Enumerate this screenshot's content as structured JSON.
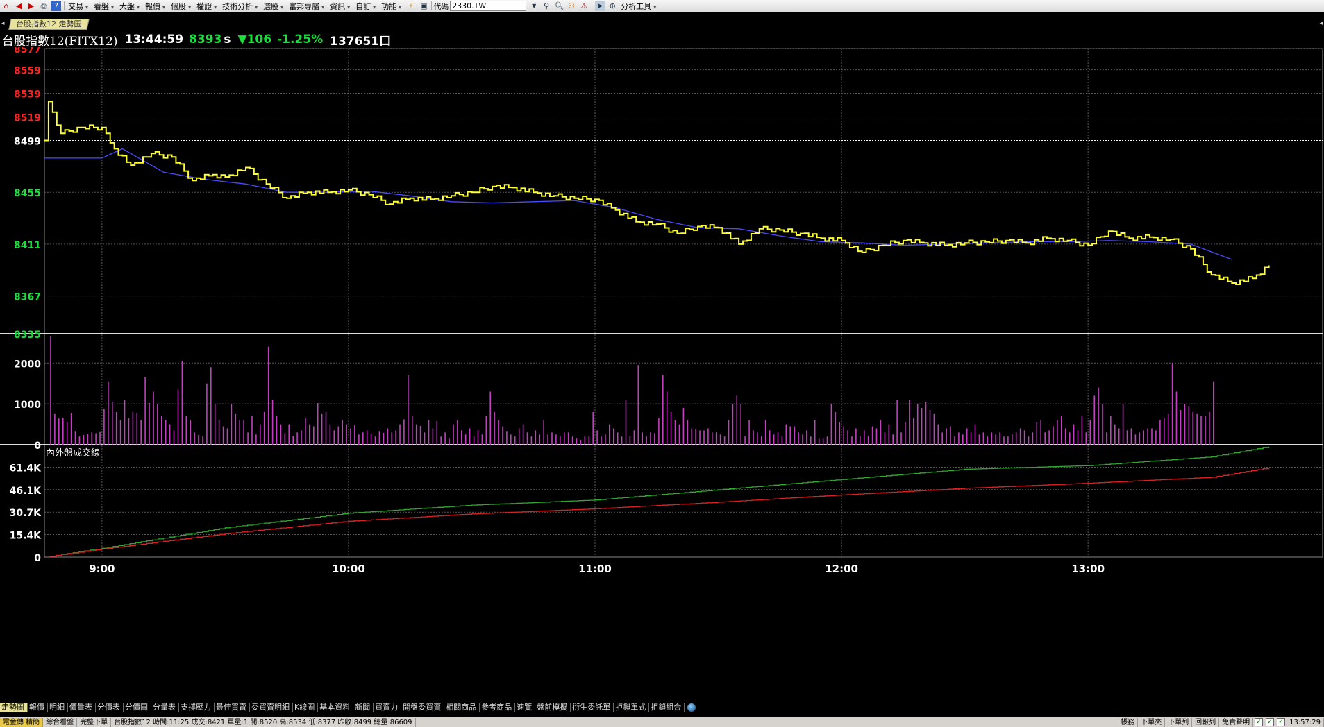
{
  "toolbar": {
    "menus": [
      "交易",
      "看盤",
      "大盤",
      "報價",
      "個股",
      "權證",
      "技術分析",
      "選股",
      "富邦專屬",
      "資訊",
      "自訂",
      "功能"
    ],
    "code_label": "代碼",
    "code_value": "2330.TW",
    "analysis_tools": "分析工具"
  },
  "tab": {
    "label": "台股指數12 走勢圖"
  },
  "header": {
    "name": "台股指數12(FITX12)",
    "time": "13:44:59",
    "price": "8393",
    "price_unit": "s",
    "change": "▼106",
    "change_pct": "-1.25%",
    "volume": "137651口"
  },
  "panels": {
    "cumulative_label": "內外盤成交線"
  },
  "colors": {
    "price_line": "#ffff33",
    "avg_line": "#4a4aff",
    "volume_bar": "#c040c0",
    "outer_line": "#2fa82f",
    "inner_line": "#e02020",
    "up": "#ff2020",
    "down": "#19e03b",
    "grid": "#555555",
    "ref_line": "#ffffff"
  },
  "chart_data": [
    {
      "type": "line",
      "title": "台股指數12(FITX12)",
      "x_axis_ticks": [
        "9:00",
        "10:00",
        "11:00",
        "12:00",
        "13:00"
      ],
      "y_axis_ticks_up": [
        "8577",
        "8559",
        "8539",
        "8519"
      ],
      "y_axis_ticks_ref": "8499",
      "y_axis_ticks_down": [
        "8455",
        "8411",
        "8367",
        "8335"
      ],
      "ylim": [
        8335,
        8577
      ],
      "reference_price": 8499,
      "series": [
        {
          "name": "price",
          "x": [
            "08:46",
            "08:47",
            "08:50",
            "08:55",
            "09:00",
            "09:03",
            "09:07",
            "09:12",
            "09:17",
            "09:22",
            "09:27",
            "09:30",
            "09:35",
            "09:40",
            "09:45",
            "09:50",
            "09:55",
            "10:00",
            "10:05",
            "10:10",
            "10:15",
            "10:20",
            "10:25",
            "10:30",
            "10:35",
            "10:40",
            "10:45",
            "10:50",
            "10:55",
            "11:00",
            "11:05",
            "11:10",
            "11:15",
            "11:20",
            "11:25",
            "11:30",
            "11:35",
            "11:40",
            "11:45",
            "11:50",
            "11:55",
            "12:00",
            "12:05",
            "12:10",
            "12:15",
            "12:20",
            "12:25",
            "12:30",
            "12:35",
            "12:40",
            "12:45",
            "12:50",
            "12:55",
            "13:00",
            "13:05",
            "13:10",
            "13:15",
            "13:20",
            "13:25",
            "13:30",
            "13:35",
            "13:40",
            "13:44"
          ],
          "values": [
            8499,
            8532,
            8505,
            8510,
            8510,
            8492,
            8478,
            8488,
            8485,
            8465,
            8470,
            8468,
            8476,
            8462,
            8450,
            8455,
            8455,
            8457,
            8453,
            8445,
            8450,
            8449,
            8452,
            8455,
            8460,
            8459,
            8455,
            8452,
            8450,
            8449,
            8440,
            8430,
            8428,
            8420,
            8426,
            8425,
            8411,
            8424,
            8423,
            8420,
            8416,
            8414,
            8404,
            8410,
            8414,
            8412,
            8410,
            8412,
            8413,
            8414,
            8412,
            8416,
            8414,
            8410,
            8422,
            8416,
            8417,
            8415,
            8407,
            8385,
            8378,
            8382,
            8393
          ]
        },
        {
          "name": "average",
          "x": [
            "08:46",
            "09:00",
            "09:05",
            "09:15",
            "09:25",
            "09:35",
            "09:45",
            "09:55",
            "10:05",
            "10:15",
            "10:25",
            "10:35",
            "10:45",
            "10:55",
            "11:05",
            "11:15",
            "11:25",
            "11:35",
            "11:45",
            "11:55",
            "12:05",
            "12:15",
            "12:25",
            "12:35",
            "12:45",
            "12:55",
            "13:05",
            "13:15",
            "13:25",
            "13:35"
          ],
          "values": [
            8484,
            8484,
            8492,
            8472,
            8466,
            8462,
            8455,
            8455,
            8456,
            8452,
            8447,
            8446,
            8447,
            8448,
            8442,
            8432,
            8425,
            8424,
            8418,
            8413,
            8412,
            8410,
            8411,
            8412,
            8413,
            8413,
            8414,
            8413,
            8411,
            8398
          ]
        }
      ]
    },
    {
      "type": "bar",
      "y_axis_ticks": [
        "2000",
        "1000",
        "0"
      ],
      "ylim": [
        0,
        2650
      ],
      "series": [
        {
          "name": "volume",
          "x_start": "08:46",
          "interval_minutes": 1,
          "values": [
            2650,
            750,
            640,
            660,
            560,
            780,
            320,
            200,
            240,
            260,
            300,
            280,
            310,
            880,
            1550,
            1050,
            800,
            600,
            1100,
            650,
            800,
            780,
            600,
            1650,
            1020,
            1300,
            1000,
            700,
            600,
            500,
            350,
            1350,
            2050,
            700,
            600,
            300,
            240,
            200,
            1500,
            1900,
            1000,
            600,
            450,
            400,
            1000,
            750,
            600,
            600,
            300,
            700,
            250,
            500,
            800,
            2400,
            1100,
            700,
            500,
            280,
            500,
            220,
            300,
            350,
            650,
            500,
            450,
            1020,
            750,
            800,
            500,
            350,
            450,
            600,
            500,
            400,
            480,
            250,
            300,
            350,
            280,
            200,
            320,
            290,
            400,
            300,
            350,
            500,
            620,
            1700,
            700,
            500,
            460,
            300,
            600,
            400,
            580,
            200,
            300,
            150,
            500,
            600,
            350,
            250,
            400,
            200,
            350,
            250,
            700,
            1300,
            800,
            600,
            450,
            320,
            250,
            200,
            400,
            500,
            300,
            200,
            350,
            250,
            600,
            250,
            300,
            250,
            200,
            300,
            300,
            200,
            150,
            120,
            200,
            200,
            800,
            350,
            200,
            250,
            500,
            400,
            300,
            200,
            1100,
            200,
            350,
            1950,
            300,
            200,
            300,
            280,
            650,
            1700,
            1300,
            800,
            600,
            500,
            900,
            600,
            400,
            380,
            350,
            350,
            400,
            300,
            300,
            250,
            200,
            600,
            1000,
            1200,
            1000,
            200,
            600,
            350,
            300,
            200,
            600,
            350,
            250,
            300,
            200,
            500,
            450,
            450,
            300,
            250,
            350,
            200,
            600,
            150,
            150,
            200,
            1000,
            800,
            550,
            450,
            350,
            200,
            400,
            200,
            350,
            220,
            450,
            400,
            600,
            300,
            500,
            250,
            1100,
            300,
            550,
            1100,
            650,
            1000,
            900,
            1050,
            850,
            750,
            500,
            300,
            400,
            450,
            200,
            300,
            250,
            400,
            300,
            500,
            250,
            300,
            200,
            300,
            250,
            300,
            200,
            200,
            250,
            300,
            400,
            350,
            200,
            300,
            550,
            600,
            300,
            350,
            450,
            600,
            700,
            400,
            300,
            500,
            350,
            700,
            300,
            600,
            1200,
            1400,
            1000,
            300,
            700,
            500,
            400,
            1000,
            350,
            400,
            250,
            300,
            350,
            400,
            400,
            350,
            600,
            650,
            750,
            2000,
            1300,
            850,
            1000,
            950,
            800,
            750,
            700,
            700,
            800,
            1550
          ]
        }
      ]
    },
    {
      "type": "line",
      "title": "內外盤成交線",
      "x_axis_ticks": [
        "9:00",
        "10:00",
        "11:00",
        "12:00",
        "13:00"
      ],
      "y_axis_ticks": [
        "61.4K",
        "46.1K",
        "30.7K",
        "15.4K",
        "0"
      ],
      "ylim": [
        0,
        76800
      ],
      "series": [
        {
          "name": "outer",
          "x": [
            "08:46",
            "09:00",
            "09:30",
            "10:00",
            "10:30",
            "11:00",
            "11:30",
            "12:00",
            "12:30",
            "13:00",
            "13:30",
            "13:44"
          ],
          "values": [
            0,
            6000,
            20000,
            30000,
            35500,
            39000,
            46000,
            53000,
            60000,
            62500,
            68500,
            75500
          ]
        },
        {
          "name": "inner",
          "x": [
            "08:46",
            "09:00",
            "09:30",
            "10:00",
            "10:30",
            "11:00",
            "11:30",
            "12:00",
            "12:30",
            "13:00",
            "13:30",
            "13:44"
          ],
          "values": [
            0,
            5500,
            16000,
            24500,
            29500,
            33000,
            37500,
            42500,
            47000,
            50500,
            54500,
            61000
          ]
        }
      ]
    }
  ],
  "bottom_tabs": [
    "走勢圖",
    "報價",
    "明細",
    "價量表",
    "分價表",
    "分價圖",
    "分量表",
    "支撐壓力",
    "最佳買賣",
    "委買賣明細",
    "K線圖",
    "基本資料",
    "新聞",
    "買賣力",
    "開盤委買賣",
    "相關商品",
    "參考商品",
    "速覽",
    "盤前模擬",
    "衍生委託單",
    "拒鎖單式",
    "拒鎖組合"
  ],
  "statusbar": {
    "brand": "電金傳 精簡",
    "item2": "綜合看盤",
    "item3": "完整下單",
    "info": "台股指數12 時間:11:25 成交:8421 單量:1 開:8520 高:8534 低:8377 昨收:8499 總量:86609",
    "right": [
      "帳務",
      "下單夾",
      "下單列",
      "回報列",
      "免責聲明"
    ],
    "clock": "13:57:29"
  }
}
